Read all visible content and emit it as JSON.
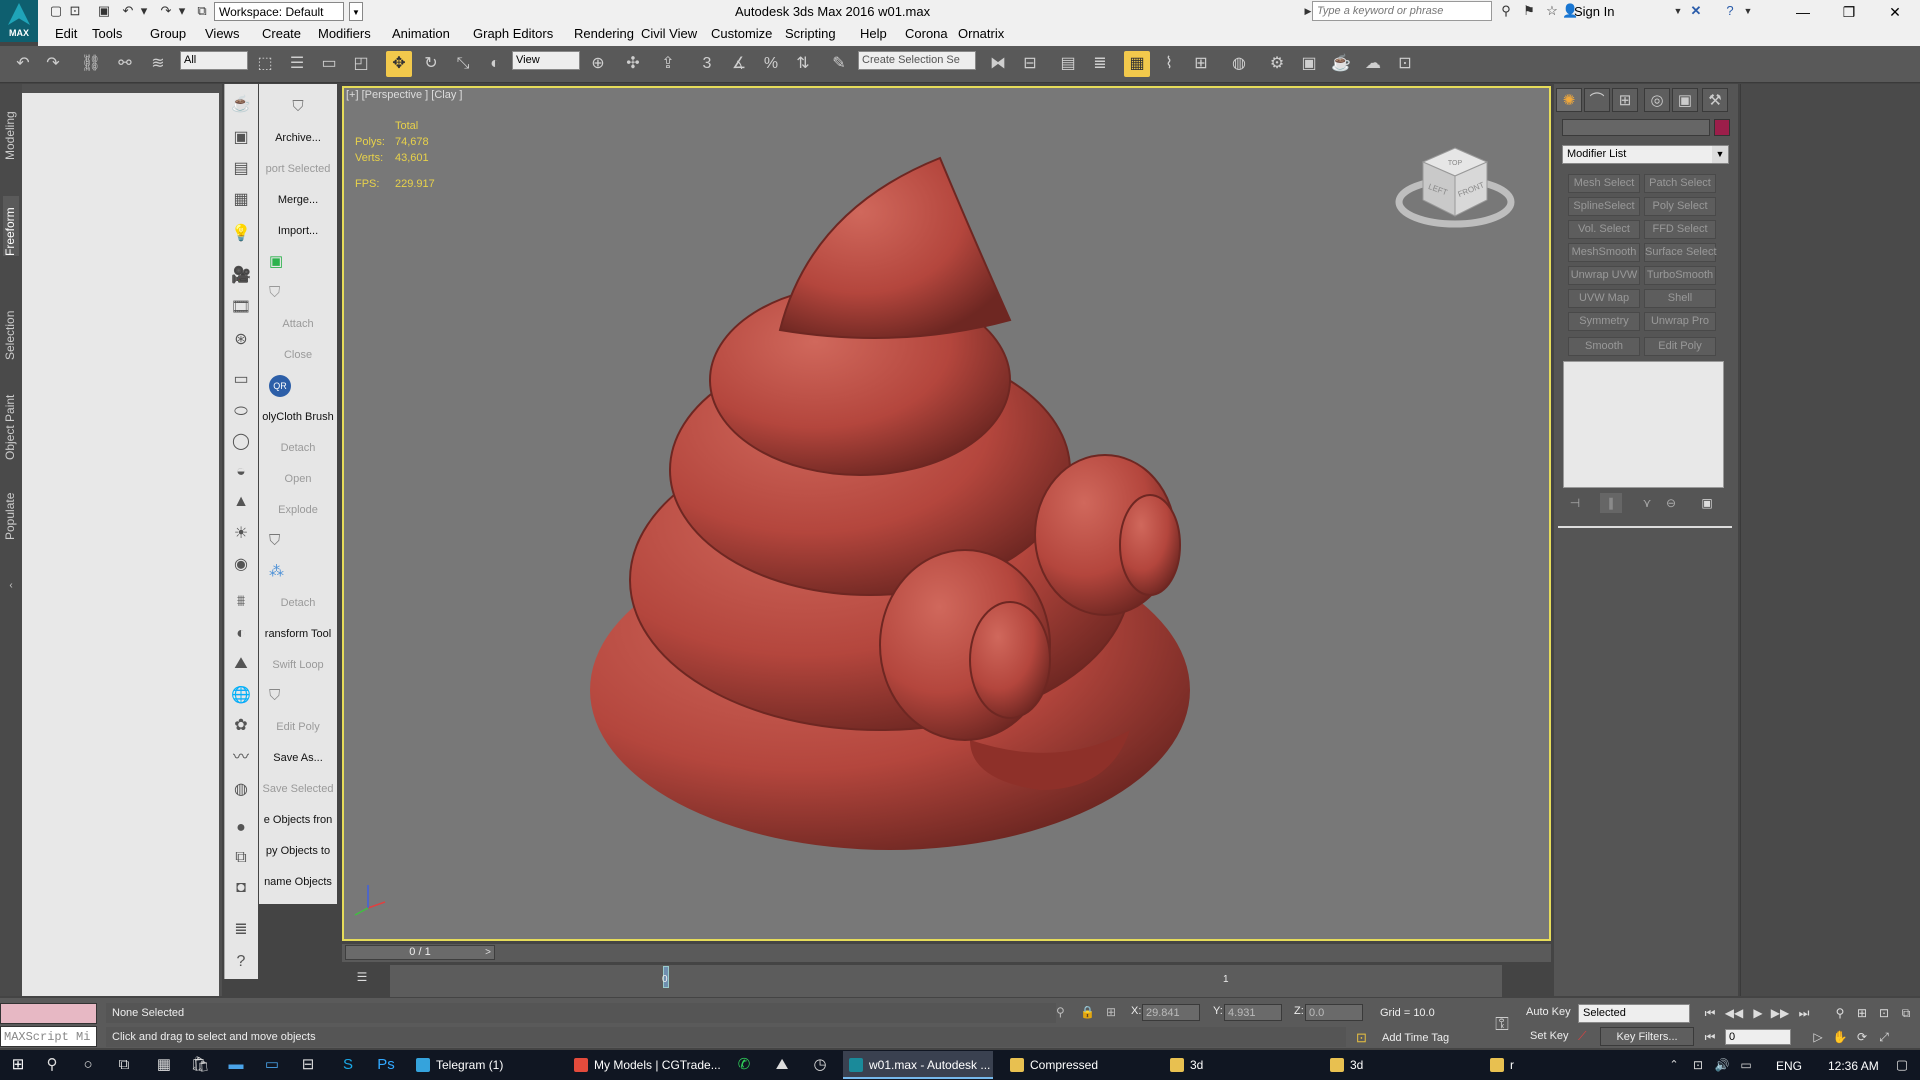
{
  "titlebar": {
    "app_icon_label": "MAX",
    "workspace": "Workspace: Default",
    "title": "Autodesk 3ds Max 2016     w01.max",
    "search_placeholder": "Type a keyword or phrase",
    "sign_in": "Sign In"
  },
  "menu": [
    "Edit",
    "Tools",
    "Group",
    "Views",
    "Create",
    "Modifiers",
    "Animation",
    "Graph Editors",
    "Rendering",
    "Civil View",
    "Customize",
    "Scripting",
    "Help",
    "Corona",
    "Ornatrix"
  ],
  "toolbar": {
    "selection_filter": "All",
    "ref_coord": "View",
    "named_selection": "Create Selection Se"
  },
  "ribbon_tabs": [
    "Modeling",
    "Freeform",
    "Selection",
    "Object Paint",
    "Populate"
  ],
  "commands": [
    {
      "label": "Archive...",
      "disabled": false
    },
    {
      "label": "port Selected",
      "disabled": true
    },
    {
      "label": "Merge...",
      "disabled": false
    },
    {
      "label": "Import...",
      "disabled": false
    },
    {
      "label": "Attach",
      "disabled": true
    },
    {
      "label": "Close",
      "disabled": true
    },
    {
      "label": "QR",
      "disabled": false
    },
    {
      "label": "olyCloth Brush",
      "disabled": false
    },
    {
      "label": "Detach",
      "disabled": true
    },
    {
      "label": "Open",
      "disabled": true
    },
    {
      "label": "Explode",
      "disabled": true
    },
    {
      "label": "Detach",
      "disabled": true
    },
    {
      "label": "ransform Tool",
      "disabled": false
    },
    {
      "label": "Swift Loop",
      "disabled": true
    },
    {
      "label": "Edit Poly",
      "disabled": true
    },
    {
      "label": "Save As...",
      "disabled": false
    },
    {
      "label": "Save Selected",
      "disabled": true
    },
    {
      "label": "e Objects fron",
      "disabled": false
    },
    {
      "label": "py Objects to",
      "disabled": false
    },
    {
      "label": "name Objects",
      "disabled": false
    }
  ],
  "viewport": {
    "label": "[+] [Perspective ] [Clay ]",
    "stats_header": "Total",
    "polys_label": "Polys:",
    "polys": "74,678",
    "verts_label": "Verts:",
    "verts": "43,601",
    "fps_label": "FPS:",
    "fps": "229.917",
    "viewcube_top": "TOP",
    "viewcube_left": "LEFT",
    "viewcube_front": "FRONT",
    "model_color": "#b4463d"
  },
  "timeline": {
    "slider": "0 / 1",
    "prev": "<",
    "next": ">",
    "tick_0": "0",
    "tick_1": "1"
  },
  "command_panel": {
    "modifier_list": "Modifier List",
    "object_color": "#9c1e4a",
    "modifier_buttons": [
      "Mesh Select",
      "Patch Select",
      "SplineSelect",
      "Poly Select",
      "Vol. Select",
      "FFD Select",
      "MeshSmooth",
      "Surface Select",
      "Unwrap UVW",
      "TurboSmooth",
      "UVW Map",
      "Shell",
      "Symmetry",
      "Unwrap Pro",
      "Smooth",
      "Edit Poly"
    ]
  },
  "status": {
    "maxscript": "MAXScript Mi",
    "selection": "None Selected",
    "prompt": "Click and drag to select and move objects",
    "x_label": "X:",
    "x": "29.841",
    "y_label": "Y:",
    "y": "4.931",
    "z_label": "Z:",
    "z": "0.0",
    "grid": "Grid = 10.0",
    "add_time_tag": "Add Time Tag",
    "auto_key": "Auto Key",
    "set_key": "Set Key",
    "selected_mode": "Selected",
    "key_filters": "Key Filters...",
    "frame": "0"
  },
  "taskbar": {
    "tasks": [
      "Telegram (1)",
      "My Models | CGTrade...",
      "w01.max - Autodesk ...",
      "Compressed",
      "3d",
      "3d",
      "r"
    ],
    "lang": "ENG",
    "time": "12:36 AM"
  }
}
